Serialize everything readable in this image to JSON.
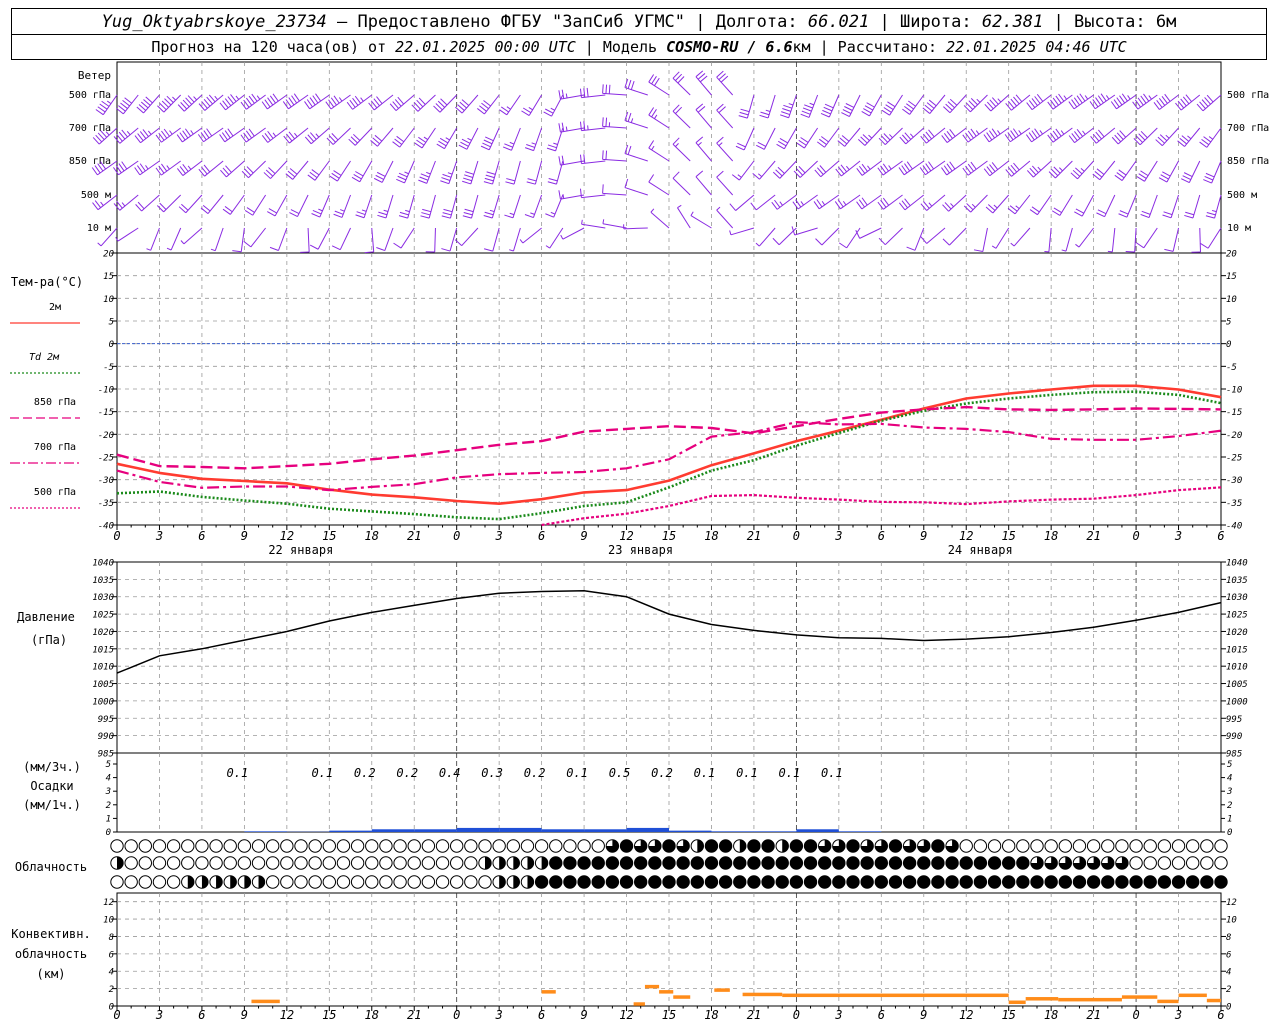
{
  "header": {
    "station": "Yug_Oktyabrskoye_23734",
    "provided_text": " – Предоставлено ФГБУ \"ЗапСиб УГМС\" | Долгота: ",
    "lon": "66.021",
    "lat_label": " | Широта: ",
    "lat": "62.381",
    "alt_label": " | Высота: ",
    "alt": "6м",
    "forecast_label": "Прогноз на 120 часа(ов) от ",
    "forecast_from": "22.01.2025 00:00 UTC",
    "model_label": " | Модель ",
    "model": "COSMO-RU / 6.6",
    "model_unit": "км",
    "computed_label": " | Рассчитано: ",
    "computed": "22.01.2025 04:46 UTC"
  },
  "time_axis": {
    "hours": [
      "0",
      "3",
      "6",
      "9",
      "12",
      "15",
      "18",
      "21",
      "0",
      "3",
      "6",
      "9",
      "12",
      "15",
      "18",
      "21",
      "0",
      "3",
      "6",
      "9",
      "12",
      "15",
      "18",
      "21",
      "0",
      "3",
      "6"
    ],
    "days": [
      "22 января",
      "23 января",
      "24 января"
    ]
  },
  "wind": {
    "title": "Ветер",
    "levels": [
      "500 гПа",
      "700 гПа",
      "850 гПа",
      "500 м",
      "10  м"
    ],
    "color": "#8a2be2"
  },
  "temperature": {
    "title": "Тем-ра(°C)",
    "legend": [
      {
        "label": "2м",
        "color": "#ff3b30",
        "style": "solid"
      },
      {
        "label": "Td 2м",
        "color": "#1a8a1a",
        "style": "dotted"
      },
      {
        "label": "850 гПа",
        "color": "#e6007e",
        "style": "dashed"
      },
      {
        "label": "700 гПа",
        "color": "#e6007e",
        "style": "dashdot"
      },
      {
        "label": "500 гПа",
        "color": "#e6007e",
        "style": "dotted"
      }
    ],
    "ticks": [
      "20",
      "15",
      "10",
      "5",
      "0",
      "-5",
      "-10",
      "-15",
      "-20",
      "-25",
      "-30",
      "-35",
      "-40"
    ]
  },
  "pressure": {
    "title": "Давление",
    "unit": "(гПа)",
    "ticks": [
      "1040",
      "1035",
      "1030",
      "1025",
      "1020",
      "1015",
      "1010",
      "1005",
      "1000",
      "995",
      "990",
      "985"
    ]
  },
  "precip": {
    "unit1": "(мм/3ч.)",
    "title": "Осадки",
    "unit2": "(мм/1ч.)",
    "ticks": [
      "5",
      "4",
      "3",
      "2",
      "1",
      "0"
    ],
    "labels": [
      "0.1",
      "0.1",
      "0.2",
      "0.2",
      "0.4",
      "0.3",
      "0.2",
      "0.1",
      "0.5",
      "0.2",
      "0.1",
      "0.1",
      "0.1",
      "0.1"
    ],
    "label_hours": [
      9,
      15,
      18,
      21,
      24,
      27,
      30,
      33,
      36,
      39,
      42,
      45,
      48,
      51
    ]
  },
  "clouds": {
    "title": "Облачность"
  },
  "convective": {
    "title1": "Конвективн.",
    "title2": "облачность",
    "unit": "(км)",
    "ticks": [
      "12",
      "10",
      "8",
      "6",
      "4",
      "2",
      "0"
    ],
    "color": "#ff8c1a"
  },
  "chart_data": [
    {
      "type": "line",
      "title": "Тем-ра(°C)",
      "ylim": [
        -40,
        20
      ],
      "x_hours": [
        0,
        3,
        6,
        9,
        12,
        15,
        18,
        21,
        24,
        27,
        30,
        33,
        36,
        39,
        42,
        45,
        48,
        51,
        54,
        57,
        60,
        63,
        66,
        69,
        72,
        75,
        78
      ],
      "series": [
        {
          "name": "2м",
          "values": [
            -26.5,
            -28.5,
            -29.8,
            -30.3,
            -30.8,
            -32.2,
            -33.3,
            -33.9,
            -34.7,
            -35.3,
            -34.3,
            -32.8,
            -32.3,
            -30.2,
            -26.8,
            -24.2,
            -21.5,
            -19.2,
            -16.8,
            -14.3,
            -12.1,
            -11.0,
            -10.1,
            -9.3,
            -9.3,
            -10.1,
            -11.8
          ]
        },
        {
          "name": "Td 2м",
          "values": [
            -33.0,
            -32.6,
            -33.8,
            -34.6,
            -35.3,
            -36.4,
            -37.0,
            -37.6,
            -38.3,
            -38.7,
            -37.4,
            -35.8,
            -35.0,
            -31.7,
            -28.0,
            -25.7,
            -22.5,
            -19.7,
            -17.0,
            -14.8,
            -13.2,
            -12.1,
            -11.3,
            -10.7,
            -10.6,
            -11.3,
            -13.1
          ]
        },
        {
          "name": "850 гПа",
          "values": [
            -24.5,
            -27.0,
            -27.2,
            -27.5,
            -27.0,
            -26.5,
            -25.5,
            -24.7,
            -23.5,
            -22.3,
            -21.5,
            -19.4,
            -18.8,
            -18.2,
            -18.6,
            -19.8,
            -18.2,
            -16.6,
            -15.2,
            -14.5,
            -14.0,
            -14.5,
            -14.6,
            -14.5,
            -14.3,
            -14.4,
            -14.5
          ]
        },
        {
          "name": "700 гПа",
          "values": [
            -28.0,
            -30.5,
            -31.8,
            -31.5,
            -31.5,
            -32.3,
            -31.6,
            -31.0,
            -29.5,
            -28.8,
            -28.5,
            -28.3,
            -27.5,
            -25.5,
            -20.5,
            -19.5,
            -17.3,
            -17.8,
            -17.7,
            -18.5,
            -18.8,
            -19.5,
            -21.0,
            -21.2,
            -21.2,
            -20.4,
            -19.2
          ]
        },
        {
          "name": "500 гПа",
          "values": [
            null,
            null,
            null,
            null,
            null,
            null,
            null,
            null,
            null,
            null,
            -40.0,
            -38.5,
            -37.5,
            -35.8,
            -33.6,
            -33.4,
            -34.0,
            -34.4,
            -34.9,
            -35.0,
            -35.4,
            -34.8,
            -34.4,
            -34.2,
            -33.4,
            -32.3,
            -31.7
          ]
        }
      ]
    },
    {
      "type": "line",
      "title": "Давление",
      "ylabel": "(гПа)",
      "ylim": [
        985,
        1040
      ],
      "x_hours": [
        0,
        3,
        6,
        9,
        12,
        15,
        18,
        21,
        24,
        27,
        30,
        33,
        36,
        39,
        42,
        45,
        48,
        51,
        54,
        57,
        60,
        63,
        66,
        69,
        72,
        75,
        78
      ],
      "series": [
        {
          "name": "Давление",
          "values": [
            1008,
            1013,
            1015,
            1017.5,
            1020,
            1023,
            1025.5,
            1027.5,
            1029.5,
            1031,
            1031.5,
            1031.7,
            1030,
            1025,
            1022,
            1020.3,
            1019,
            1018.2,
            1018,
            1017.4,
            1017.8,
            1018.5,
            1019.7,
            1021.2,
            1023.2,
            1025.5,
            1028.3
          ]
        }
      ]
    },
    {
      "type": "bar",
      "title": "Осадки",
      "ylabel": "(мм/1ч.)",
      "ylim": [
        0,
        5
      ],
      "x_hours": [
        9,
        12,
        15,
        18,
        21,
        24,
        27,
        30,
        33,
        36,
        39,
        42,
        45,
        48,
        51
      ],
      "values": [
        0.05,
        0.02,
        0.1,
        0.2,
        0.2,
        0.3,
        0.3,
        0.2,
        0.2,
        0.3,
        0.1,
        0.05,
        0.05,
        0.2,
        0.05
      ]
    },
    {
      "type": "bar",
      "title": "Конвективн. облачность",
      "ylabel": "(км)",
      "ylim": [
        0,
        13
      ],
      "segments": [
        {
          "x0": 9.5,
          "x1": 11.5,
          "value": 0.5
        },
        {
          "x0": 30,
          "x1": 31,
          "value": 1.6
        },
        {
          "x0": 36.5,
          "x1": 37.3,
          "value": 0.2
        },
        {
          "x0": 37.3,
          "x1": 38.3,
          "value": 2.2
        },
        {
          "x0": 38.3,
          "x1": 39.3,
          "value": 1.6
        },
        {
          "x0": 39.3,
          "x1": 40.5,
          "value": 1.0
        },
        {
          "x0": 42.2,
          "x1": 43.3,
          "value": 1.8
        },
        {
          "x0": 44.2,
          "x1": 47,
          "value": 1.3
        },
        {
          "x0": 47,
          "x1": 63,
          "value": 1.2
        },
        {
          "x0": 63,
          "x1": 64.2,
          "value": 0.4
        },
        {
          "x0": 64.2,
          "x1": 66.5,
          "value": 0.8
        },
        {
          "x0": 66.5,
          "x1": 71,
          "value": 0.7
        },
        {
          "x0": 71,
          "x1": 73.5,
          "value": 1.0
        },
        {
          "x0": 73.5,
          "x1": 75,
          "value": 0.5
        },
        {
          "x0": 75,
          "x1": 77,
          "value": 1.2
        },
        {
          "x0": 77,
          "x1": 78,
          "value": 0.6
        }
      ]
    }
  ]
}
